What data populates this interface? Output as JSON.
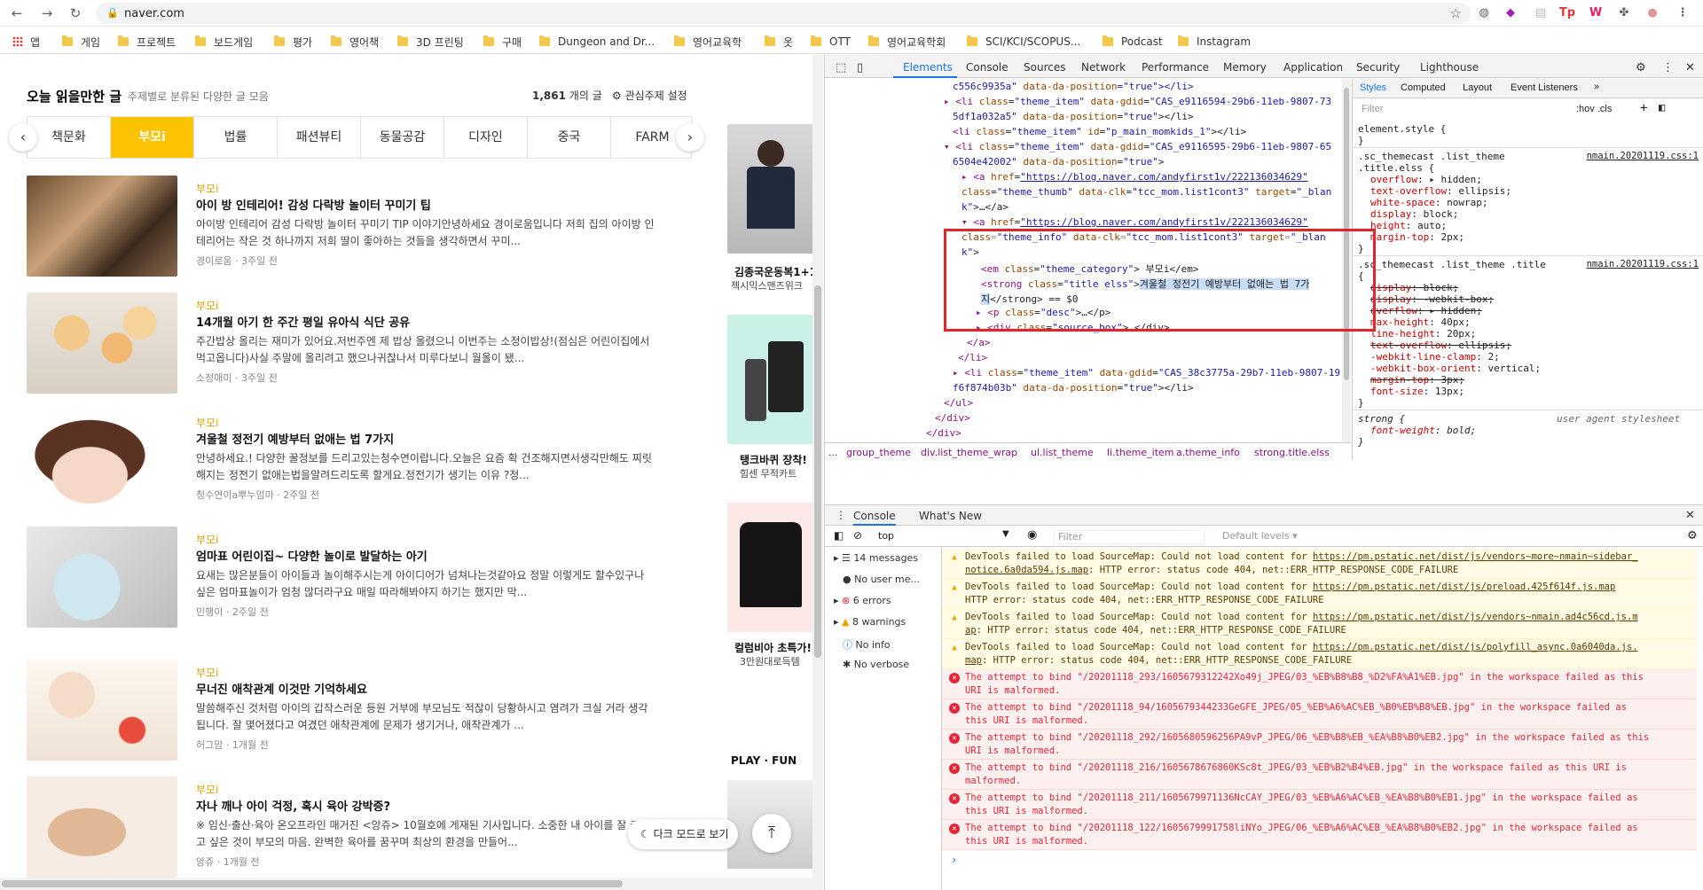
{
  "browser": {
    "url": "naver.com",
    "bookmarks": [
      "앱",
      "게임",
      "프로젝트",
      "보드게임",
      "평가",
      "영어책",
      "3D 프린팅",
      "구매",
      "Dungeon and Dr...",
      "영어교육학",
      "옷",
      "OTT",
      "영어교육학회",
      "SCI/KCI/SCOPUS...",
      "Podcast",
      "Instagram"
    ]
  },
  "page": {
    "section_title": "오늘 읽을만한 글",
    "section_subtitle": "주제별로 분류된 다양한 글 모음",
    "count_number": "1,861",
    "count_suffix": "개의 글",
    "setting_label": "관심주제 설정",
    "tabs": [
      "책문화",
      "부모i",
      "법률",
      "패션뷰티",
      "동물공감",
      "디자인",
      "중국",
      "FARM"
    ],
    "articles": [
      {
        "category": "부모i",
        "title": "아이 방 인테리어! 감성 다락방 놀이터 꾸미기 팁",
        "desc": "아이방 인테리어 감성 다락방 놀이터 꾸미기 TIP 이야기안녕하세요 경이로움입니다 저희 집의 아이방 인테리어는 작은 것 하나까지 저희 딸이 좋아하는 것들을 생각하면서 꾸미...",
        "source": "경이로움 · 3주일 전"
      },
      {
        "category": "부모i",
        "title": "14개월 아기 한 주간 평일 유아식 식단 공유",
        "desc": "주간밥상 올리는 재미가 있어요.저번주엔 제 밥상 올렸으니 이번주는 소정이밥상!(점심은 어린이집에서 먹고옵니다)사실 주말에 올리려고 했으나귀찮나서 미루다보니 월올이 됐...",
        "source": "소정애미 · 3주일 전"
      },
      {
        "category": "부모i",
        "title": "겨울철 정전기 예방부터 없애는 법 7가지",
        "desc": "안녕하세요.! 다양한 꿀정보를 드리고있는청수연이랍니다.오늘은 요즘 확 건조해지면서생각만해도 찌릿해지는 정전기 없애는법을알려드리도록 할게요.정전기가 생기는 이유 ?정...",
        "source": "청수연이a뿌누엄마 · 2주일 전"
      },
      {
        "category": "부모i",
        "title": "엄마표 어린이집~ 다양한 놀이로 발달하는 아기",
        "desc": "요새는 많은분들이 아이들과 놀이해주시는게 아이디어가 넘쳐나는것같아요 정말 이렇게도 할수있구나 싶은 엄마표놀이가 엄청 많더라구요 매일 따라해봐야지 하기는 했지만 막...",
        "source": "민행이 · 2주일 전"
      },
      {
        "category": "부모i",
        "title": "무너진 애착관계 이것만 기억하세요",
        "desc": "말씀해주신 것처럼 아이의 갑작스러운 등원 거부에 부모님도 적잖이 당황하시고 염려가 크실 거라 생각됩니다. 잘 몇어졌다고 여겼던 애착관계에 문제가 생기거나, 애착관계가 ...",
        "source": "허그맘 · 1개월 전"
      },
      {
        "category": "부모i",
        "title": "자나 깨나 아이 걱정, 혹시 육아 강박증?",
        "desc": "※ 임신·출산·육아 온오프라인 매거진 <앙쥬> 10월호에 게재된 기사입니다. 소중한 내 아이를 잘 키우고 싶은 것이 부모의 마음. 완벽한 육아를 꿈꾸며 최상의 환경을 만들어...",
        "source": "앙쥬 · 1개월 전"
      }
    ],
    "right_items": [
      {
        "title": "김종국운동복1+1",
        "sub": "젝시믹스맨즈위크"
      },
      {
        "title": "탱크바퀴 장착!",
        "sub": "힘센 무적카트"
      },
      {
        "title": "컬럼비아 초특가!",
        "sub": "3만원대로득템"
      }
    ],
    "right_section_label": "PLAY · FUN",
    "dark_mode_label": "다크 모드로 보기"
  },
  "devtools": {
    "tabs": [
      "Elements",
      "Console",
      "Sources",
      "Network",
      "Performance",
      "Memory",
      "Application",
      "Security",
      "Lighthouse"
    ],
    "styles_tabs": [
      "Styles",
      "Computed",
      "Layout",
      "Event Listeners"
    ],
    "styles_filter_placeholder": "Filter",
    "hov_cls": ":hov .cls",
    "breadcrumbs": [
      "...",
      "group_theme",
      "div.list_theme_wrap",
      "ul.list_theme",
      "li.theme_item",
      "a.theme_info",
      "strong.title.elss"
    ],
    "console_tabs": [
      "Console",
      "What's New"
    ],
    "console_context": "top",
    "console_filter_placeholder": "Filter",
    "levels_label": "Default levels ▾",
    "sidebar": [
      "14 messages",
      "No user me...",
      "6 errors",
      "8 warnings",
      "No info",
      "No verbose"
    ],
    "messages": [
      {
        "type": "warn",
        "text": "DevTools failed to load SourceMap: Could not load content for ",
        "link": "https://pm.pstatic.net/dist/js/vendors~more~nmain~sidebar_",
        "line2link": "notice.6a0da594.js.map",
        "line2": ": HTTP error: status code 404, net::ERR_HTTP_RESPONSE_CODE_FAILURE"
      },
      {
        "type": "warn",
        "text": "DevTools failed to load SourceMap: Could not load content for ",
        "link": "https://pm.pstatic.net/dist/js/preload.425f614f.js.map",
        "line2link": "",
        "line2": "HTTP error: status code 404, net::ERR_HTTP_RESPONSE_CODE_FAILURE"
      },
      {
        "type": "warn",
        "text": "DevTools failed to load SourceMap: Could not load content for ",
        "link": "https://pm.pstatic.net/dist/js/vendors~nmain.ad4c56cd.js.m",
        "line2link": "ap",
        "line2": ": HTTP error: status code 404, net::ERR_HTTP_RESPONSE_CODE_FAILURE"
      },
      {
        "type": "warn",
        "text": "DevTools failed to load SourceMap: Could not load content for ",
        "link": "https://pm.pstatic.net/dist/js/polyfill_async.0a6040da.js.",
        "line2link": "map",
        "line2": ": HTTP error: status code 404, net::ERR_HTTP_RESPONSE_CODE_FAILURE"
      },
      {
        "type": "err",
        "text": "The attempt to bind \"/20201118_293/1605679312242Xo49j_JPEG/03_%EB%B8%B8_%D2%FA%A1%EB.jpg\" in the workspace failed as this",
        "link": "",
        "line2link": "",
        "line2": "URI is malformed."
      },
      {
        "type": "err",
        "text": "The attempt to bind \"/20201118_94/1605679344233GeGFE_JPEG/05_%EB%A6%AC%EB_%B0%EB%B8%EB.jpg\" in the workspace failed as",
        "link": "",
        "line2link": "",
        "line2": "this URI is malformed."
      },
      {
        "type": "err",
        "text": "The attempt to bind \"/20201118_292/1605680596256PA9vP_JPEG/06_%EB%B8%EB_%EA%B8%B0%EB2.jpg\" in the workspace failed as this",
        "link": "",
        "line2link": "",
        "line2": "URI is malformed."
      },
      {
        "type": "err",
        "text": "The attempt to bind \"/20201118_216/1605678676860KSc8t_JPEG/03_%EB%B2%B4%EB.jpg\" in the workspace failed as this URI is",
        "link": "",
        "line2link": "",
        "line2": "malformed."
      },
      {
        "type": "err",
        "text": "The attempt to bind \"/20201118_211/1605679971136NcCAY_JPEG/03_%EB%A6%AC%EB_%EA%B8%B0%EB1.jpg\" in the workspace failed as",
        "link": "",
        "line2link": "",
        "line2": "this URI is malformed."
      },
      {
        "type": "err",
        "text": "The attempt to bind \"/20201118_122/1605679991758liNYo_JPEG/06_%EB%A6%AC%EB_%EA%B8%B0%EB2.jpg\" in the workspace failed as",
        "link": "",
        "line2link": "",
        "line2": "this URI is malformed."
      }
    ]
  },
  "colors": {
    "accent": "#fcc300",
    "category": "#d7a100",
    "devtools_blue": "#1a73e8",
    "highlight_red": "#e3242b"
  }
}
